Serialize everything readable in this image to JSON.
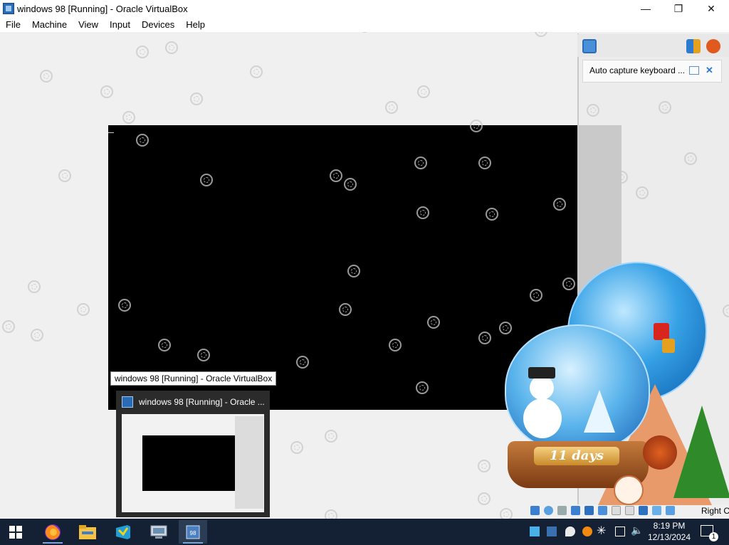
{
  "window": {
    "title": "windows 98 [Running] - Oracle VirtualBox",
    "minimize_glyph": "—",
    "maximize_glyph": "❐",
    "close_glyph": "✕"
  },
  "menu": [
    "File",
    "Machine",
    "View",
    "Input",
    "Devices",
    "Help"
  ],
  "side_panel": {
    "message": "Auto capture keyboard ..."
  },
  "tooltip": "windows 98 [Running] - Oracle VirtualBox",
  "preview": {
    "title": "windows 98 [Running] - Oracle ..."
  },
  "status_bar": {
    "host_key": "Right Ctrl"
  },
  "widget": {
    "countdown": "11 days"
  },
  "taskbar": {
    "apps": [
      "start-icon",
      "firefox-icon",
      "file-explorer-icon",
      "visual-studio-icon",
      "network-icon",
      "virtualbox-icon"
    ],
    "time": "8:19 PM",
    "date": "12/13/2024",
    "notifications": "1"
  }
}
